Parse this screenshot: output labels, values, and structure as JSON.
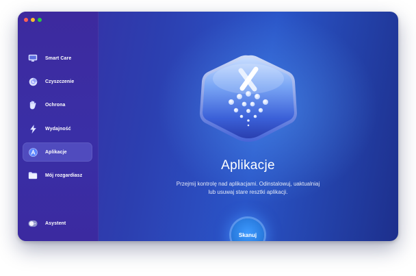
{
  "sidebar": {
    "items": [
      {
        "label": "Smart Care",
        "icon": "monitor-icon"
      },
      {
        "label": "Czyszczenie",
        "icon": "disk-icon"
      },
      {
        "label": "Ochrona",
        "icon": "hand-icon"
      },
      {
        "label": "Wydajność",
        "icon": "lightning-icon"
      },
      {
        "label": "Aplikacje",
        "icon": "apps-icon",
        "active": true
      },
      {
        "label": "Mój rozgardiasz",
        "icon": "folder-icon"
      }
    ],
    "assistant": {
      "label": "Asystent",
      "icon": "assistant-toggle-icon"
    }
  },
  "main": {
    "title": "Aplikacje",
    "description_line1": "Przejmij kontrolę nad aplikacjami. Odinstalowuj, uaktualniaj",
    "description_line2": "lub usuwaj stare resztki aplikacji."
  },
  "scan_button": {
    "label": "Skanuj"
  },
  "colors": {
    "accent": "#2a7de0",
    "sidebar_bg": "#3a2fa6",
    "traffic_red": "#ff5f57",
    "traffic_yellow": "#febc2e",
    "traffic_green": "#28c840"
  }
}
